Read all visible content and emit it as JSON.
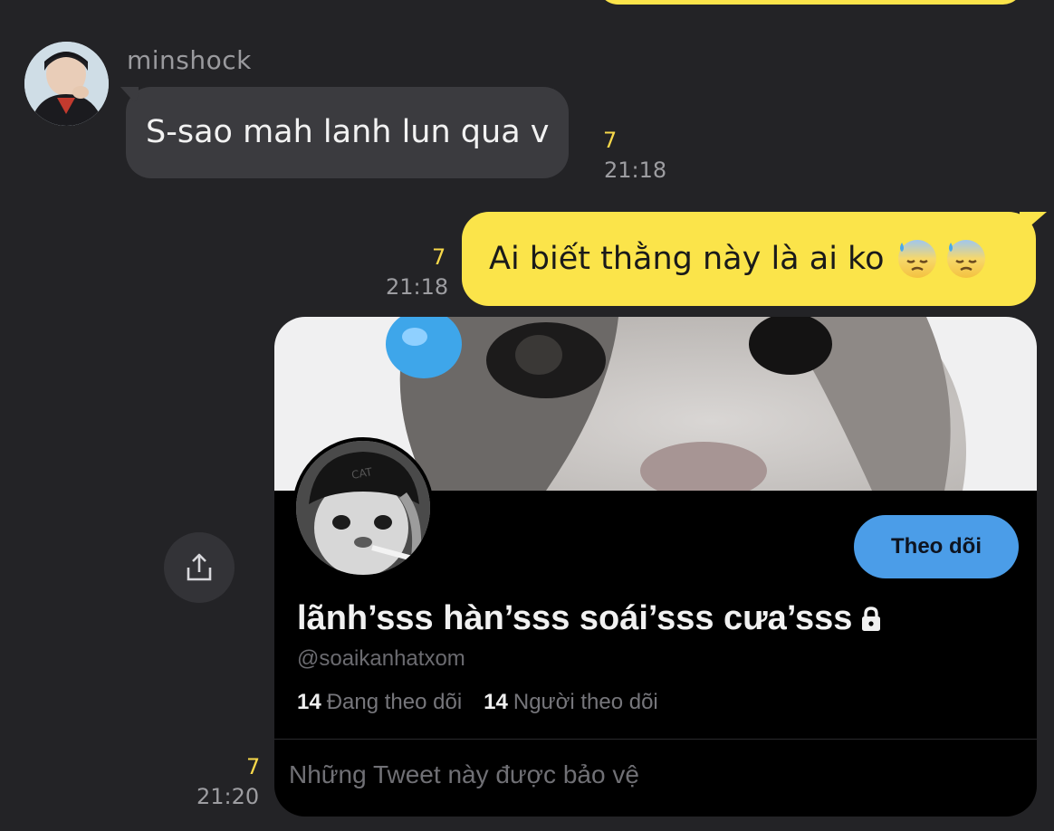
{
  "chat": {
    "messages": [
      {
        "direction": "incoming",
        "sender": "minshock",
        "text": "S-sao mah lanh lun qua v",
        "read_count": "7",
        "time": "21:18"
      },
      {
        "direction": "outgoing",
        "text": "Ai biết thằng này là ai ko",
        "emojis": [
          "downcast-face-with-sweat-emoji",
          "downcast-face-with-sweat-emoji"
        ],
        "read_count": "7",
        "time": "21:18"
      },
      {
        "direction": "outgoing",
        "type": "image",
        "read_count": "7",
        "time": "21:20",
        "profile_card": {
          "follow_label": "Theo dõi",
          "display_name": "lãnh’sss hàn’sss soái’sss cưa’sss",
          "handle": "@soaikanhatxom",
          "following_count": "14",
          "following_label": "Đang theo dõi",
          "followers_count": "14",
          "followers_label": "Người theo dõi",
          "protected_notice": "Những Tweet này được bảo vệ"
        }
      }
    ]
  },
  "colors": {
    "background": "#232326",
    "incoming_bubble": "#3b3b3f",
    "outgoing_bubble": "#fbe44a",
    "read_count": "#f7d84a",
    "follow_button": "#4b9de8"
  },
  "icons": [
    "share-icon",
    "lock-icon",
    "avatar"
  ]
}
